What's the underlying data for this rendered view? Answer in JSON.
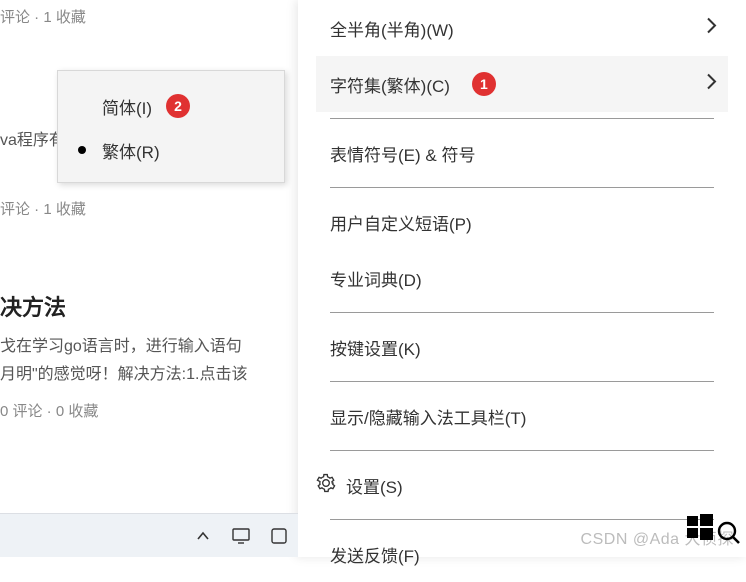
{
  "background": {
    "meta_top": "评论 · 1 收藏",
    "line1": "va程序有",
    "meta_mid": "评论 · 1 收藏",
    "title": "决方法",
    "para1": "戈在学习go语言时，进行输入语句",
    "para2": "月明\"的感觉呀！解决方法:1.点击该",
    "meta_bottom": "0 评论 · 0 收藏"
  },
  "submenu": {
    "items": [
      {
        "label": "简体(I)",
        "badge": "2",
        "selected": false
      },
      {
        "label": "繁体(R)",
        "badge": null,
        "selected": true
      }
    ]
  },
  "main_menu": {
    "items": [
      {
        "label": "全半角(半角)(W)",
        "arrow": true
      },
      {
        "label": "字符集(繁体)(C)",
        "arrow": true,
        "badge": "1",
        "highlight": true
      },
      {
        "sep": true
      },
      {
        "label": "表情符号(E) & 符号"
      },
      {
        "sep": true
      },
      {
        "label": "用户自定义短语(P)"
      },
      {
        "label": "专业词典(D)"
      },
      {
        "sep": true
      },
      {
        "label": "按键设置(K)"
      },
      {
        "sep": true
      },
      {
        "label": "显示/隐藏输入法工具栏(T)"
      },
      {
        "sep": true
      },
      {
        "label": "设置(S)",
        "gear": true
      },
      {
        "sep": true
      },
      {
        "label": "发送反馈(F)"
      }
    ]
  },
  "watermark": "CSDN @Ada 大侦探",
  "annotation_badges": {
    "1": "1",
    "2": "2"
  }
}
